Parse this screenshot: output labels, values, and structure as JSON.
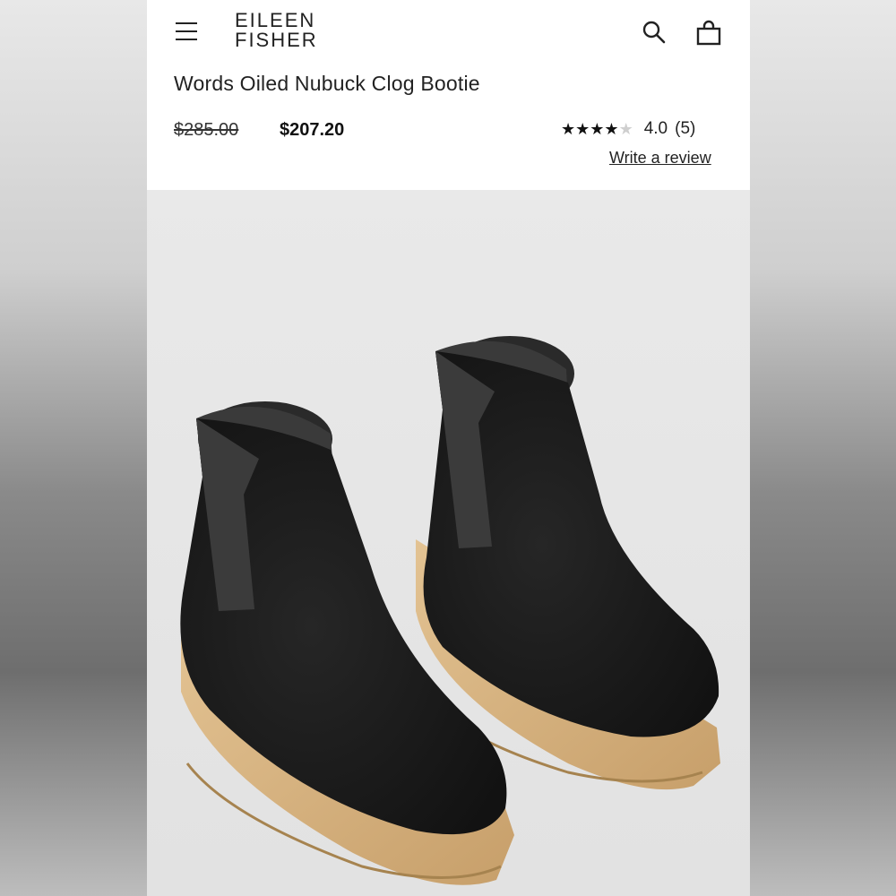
{
  "brand": {
    "line1": "EILEEN",
    "line2": "FISHER"
  },
  "header": {
    "menu_icon": "hamburger-menu-icon",
    "search_icon": "search-icon",
    "bag_icon": "shopping-bag-icon"
  },
  "product": {
    "title": "Words Oiled Nubuck Clog Bootie",
    "price_original": "$285.00",
    "price_sale": "$207.20",
    "rating": "4.0",
    "rating_stars": 4,
    "rating_max": 5,
    "review_count": "(5)",
    "write_review_label": "Write a review"
  },
  "colors": {
    "text": "#222222",
    "boot_leather": "#1c1c1c",
    "boot_felt": "#3a3a3a",
    "sole_wood": "#d7b483",
    "background": "#e6e6e6"
  }
}
